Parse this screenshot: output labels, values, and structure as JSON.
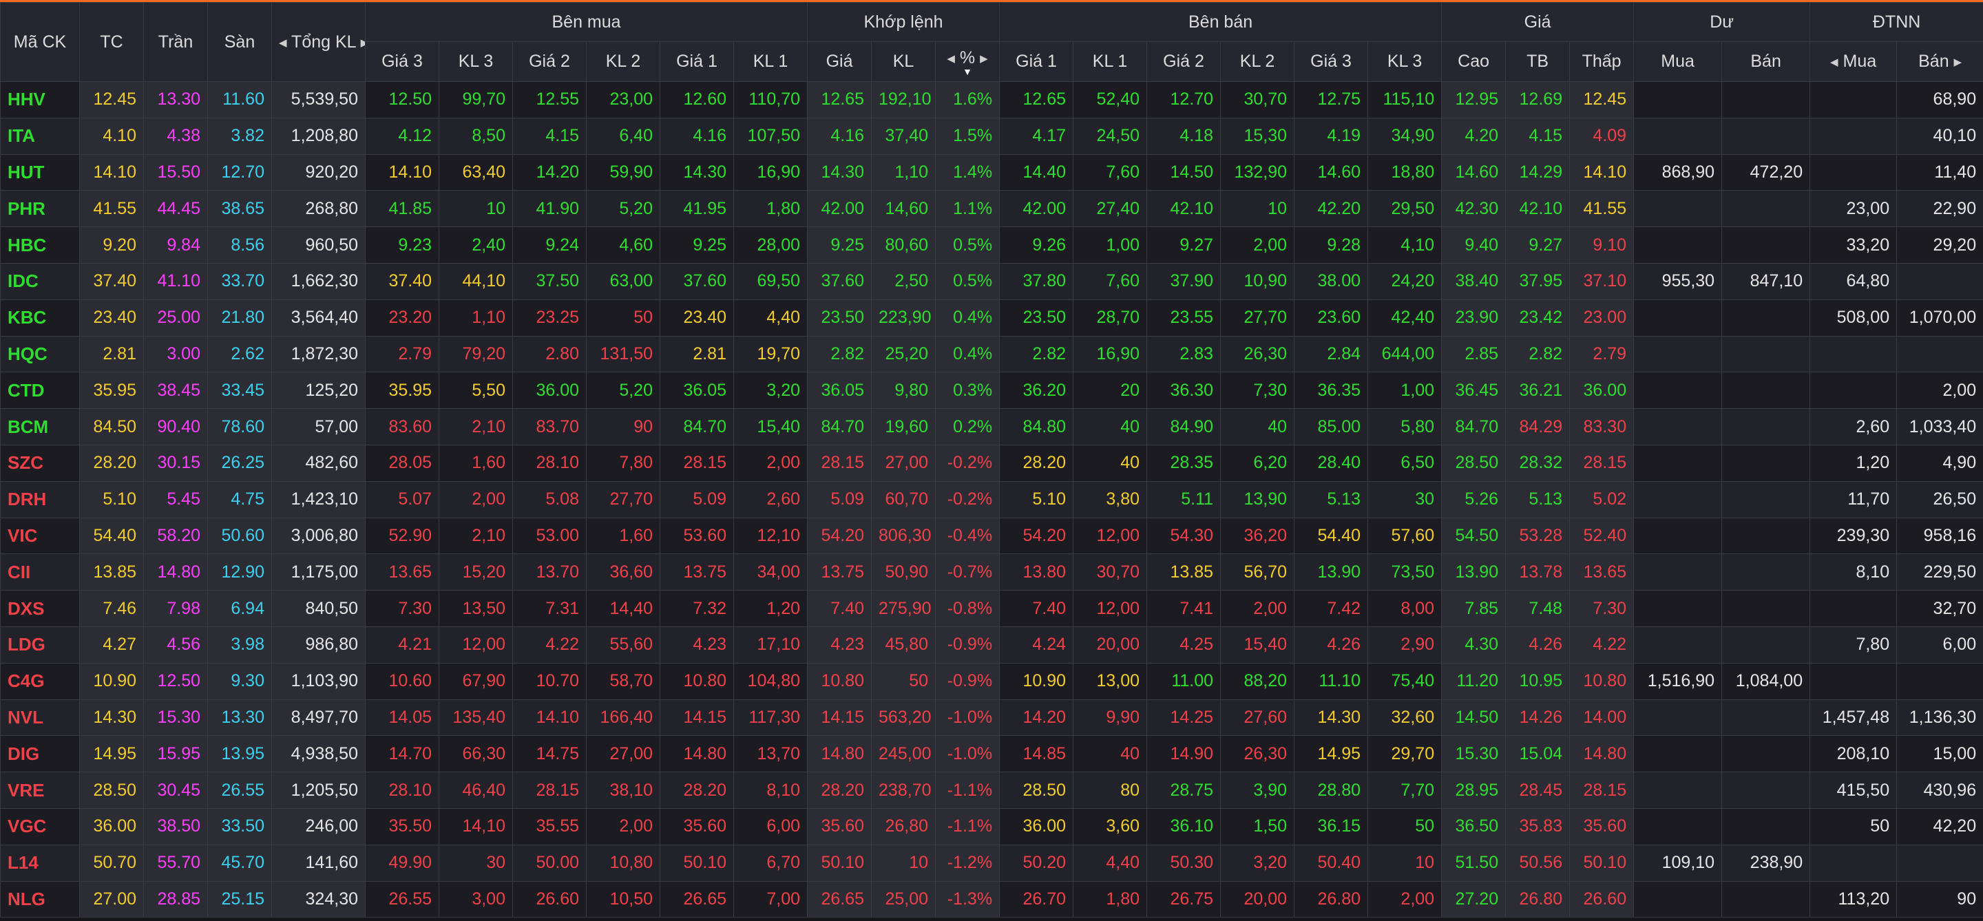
{
  "headers": {
    "symbol": "Mã CK",
    "ref": "TC",
    "ceil": "Trần",
    "floor": "Sàn",
    "total_vol": "Tổng KL",
    "buy_group": "Bên mua",
    "match_group": "Khớp lệnh",
    "sell_group": "Bên bán",
    "price_group": "Giá",
    "remain_group": "Dư",
    "foreign_group": "ĐTNN",
    "buy_cols": [
      "Giá 3",
      "KL 3",
      "Giá 2",
      "KL 2",
      "Giá 1",
      "KL 1"
    ],
    "match_cols": [
      "Giá",
      "KL",
      "%"
    ],
    "sell_cols": [
      "Giá 1",
      "KL 1",
      "Giá 2",
      "KL 2",
      "Giá 3",
      "KL 3"
    ],
    "price_cols": [
      "Cao",
      "TB",
      "Thấp"
    ],
    "remain_cols": [
      "Mua",
      "Bán"
    ],
    "foreign_cols": [
      "Mua",
      "Bán"
    ]
  },
  "colors": {
    "up": "#2ede2e",
    "down": "#f04048",
    "ref": "#f2cc2a",
    "ceil": "#ff3dff",
    "floor": "#3ad1ef",
    "accent": "#f26b1d"
  },
  "rows": [
    {
      "sym": "HHV",
      "tc": "12.45",
      "tran": "13.30",
      "san": "11.60",
      "tkl": "5,539,50",
      "b3p": "12.50",
      "b3v": "99,70",
      "b2p": "12.55",
      "b2v": "23,00",
      "b1p": "12.60",
      "b1v": "110,70",
      "mp": "12.65",
      "mv": "192,10",
      "pct": "1.6%",
      "s1p": "12.65",
      "s1v": "52,40",
      "s2p": "12.70",
      "s2v": "30,70",
      "s3p": "12.75",
      "s3v": "115,10",
      "cao": "12.95",
      "tb": "12.69",
      "thap": "12.45",
      "dm": "",
      "db": "",
      "fm": "",
      "fb": "68,90",
      "cl": {
        "b3": "up",
        "b2": "up",
        "b1": "up",
        "m": "up",
        "s1": "up",
        "s2": "up",
        "s3": "up",
        "cao": "up",
        "tb": "up",
        "thap": "ref"
      }
    },
    {
      "sym": "ITA",
      "tc": "4.10",
      "tran": "4.38",
      "san": "3.82",
      "tkl": "1,208,80",
      "b3p": "4.12",
      "b3v": "8,50",
      "b2p": "4.15",
      "b2v": "6,40",
      "b1p": "4.16",
      "b1v": "107,50",
      "mp": "4.16",
      "mv": "37,40",
      "pct": "1.5%",
      "s1p": "4.17",
      "s1v": "24,50",
      "s2p": "4.18",
      "s2v": "15,30",
      "s3p": "4.19",
      "s3v": "34,90",
      "cao": "4.20",
      "tb": "4.15",
      "thap": "4.09",
      "dm": "",
      "db": "",
      "fm": "",
      "fb": "40,10",
      "cl": {
        "b3": "up",
        "b2": "up",
        "b1": "up",
        "m": "up",
        "s1": "up",
        "s2": "up",
        "s3": "up",
        "cao": "up",
        "tb": "up",
        "thap": "dn"
      }
    },
    {
      "sym": "HUT",
      "tc": "14.10",
      "tran": "15.50",
      "san": "12.70",
      "tkl": "920,20",
      "b3p": "14.10",
      "b3v": "63,40",
      "b2p": "14.20",
      "b2v": "59,90",
      "b1p": "14.30",
      "b1v": "16,90",
      "mp": "14.30",
      "mv": "1,10",
      "pct": "1.4%",
      "s1p": "14.40",
      "s1v": "7,60",
      "s2p": "14.50",
      "s2v": "132,90",
      "s3p": "14.60",
      "s3v": "18,80",
      "cao": "14.60",
      "tb": "14.29",
      "thap": "14.10",
      "dm": "868,90",
      "db": "472,20",
      "fm": "",
      "fb": "11,40",
      "cl": {
        "b3": "ref",
        "b2": "up",
        "b1": "up",
        "m": "up",
        "s1": "up",
        "s2": "up",
        "s3": "up",
        "cao": "up",
        "tb": "up",
        "thap": "ref"
      }
    },
    {
      "sym": "PHR",
      "tc": "41.55",
      "tran": "44.45",
      "san": "38.65",
      "tkl": "268,80",
      "b3p": "41.85",
      "b3v": "10",
      "b2p": "41.90",
      "b2v": "5,20",
      "b1p": "41.95",
      "b1v": "1,80",
      "mp": "42.00",
      "mv": "14,60",
      "pct": "1.1%",
      "s1p": "42.00",
      "s1v": "27,40",
      "s2p": "42.10",
      "s2v": "10",
      "s3p": "42.20",
      "s3v": "29,50",
      "cao": "42.30",
      "tb": "42.10",
      "thap": "41.55",
      "dm": "",
      "db": "",
      "fm": "23,00",
      "fb": "22,90",
      "cl": {
        "b3": "up",
        "b2": "up",
        "b1": "up",
        "m": "up",
        "s1": "up",
        "s2": "up",
        "s3": "up",
        "cao": "up",
        "tb": "up",
        "thap": "ref"
      }
    },
    {
      "sym": "HBC",
      "tc": "9.20",
      "tran": "9.84",
      "san": "8.56",
      "tkl": "960,50",
      "b3p": "9.23",
      "b3v": "2,40",
      "b2p": "9.24",
      "b2v": "4,60",
      "b1p": "9.25",
      "b1v": "28,00",
      "mp": "9.25",
      "mv": "80,60",
      "pct": "0.5%",
      "s1p": "9.26",
      "s1v": "1,00",
      "s2p": "9.27",
      "s2v": "2,00",
      "s3p": "9.28",
      "s3v": "4,10",
      "cao": "9.40",
      "tb": "9.27",
      "thap": "9.10",
      "dm": "",
      "db": "",
      "fm": "33,20",
      "fb": "29,20",
      "cl": {
        "b3": "up",
        "b2": "up",
        "b1": "up",
        "m": "up",
        "s1": "up",
        "s2": "up",
        "s3": "up",
        "cao": "up",
        "tb": "up",
        "thap": "dn"
      }
    },
    {
      "sym": "IDC",
      "tc": "37.40",
      "tran": "41.10",
      "san": "33.70",
      "tkl": "1,662,30",
      "b3p": "37.40",
      "b3v": "44,10",
      "b2p": "37.50",
      "b2v": "63,00",
      "b1p": "37.60",
      "b1v": "69,50",
      "mp": "37.60",
      "mv": "2,50",
      "pct": "0.5%",
      "s1p": "37.80",
      "s1v": "7,60",
      "s2p": "37.90",
      "s2v": "10,90",
      "s3p": "38.00",
      "s3v": "24,20",
      "cao": "38.40",
      "tb": "37.95",
      "thap": "37.10",
      "dm": "955,30",
      "db": "847,10",
      "fm": "64,80",
      "fb": "",
      "cl": {
        "b3": "ref",
        "b2": "up",
        "b1": "up",
        "m": "up",
        "s1": "up",
        "s2": "up",
        "s3": "up",
        "cao": "up",
        "tb": "up",
        "thap": "dn"
      }
    },
    {
      "sym": "KBC",
      "tc": "23.40",
      "tran": "25.00",
      "san": "21.80",
      "tkl": "3,564,40",
      "b3p": "23.20",
      "b3v": "1,10",
      "b2p": "23.25",
      "b2v": "50",
      "b1p": "23.40",
      "b1v": "4,40",
      "mp": "23.50",
      "mv": "223,90",
      "pct": "0.4%",
      "s1p": "23.50",
      "s1v": "28,70",
      "s2p": "23.55",
      "s2v": "27,70",
      "s3p": "23.60",
      "s3v": "42,40",
      "cao": "23.90",
      "tb": "23.42",
      "thap": "23.00",
      "dm": "",
      "db": "",
      "fm": "508,00",
      "fb": "1,070,00",
      "cl": {
        "b3": "dn",
        "b2": "dn",
        "b1": "ref",
        "m": "up",
        "s1": "up",
        "s2": "up",
        "s3": "up",
        "cao": "up",
        "tb": "up",
        "thap": "dn"
      }
    },
    {
      "sym": "HQC",
      "tc": "2.81",
      "tran": "3.00",
      "san": "2.62",
      "tkl": "1,872,30",
      "b3p": "2.79",
      "b3v": "79,20",
      "b2p": "2.80",
      "b2v": "131,50",
      "b1p": "2.81",
      "b1v": "19,70",
      "mp": "2.82",
      "mv": "25,20",
      "pct": "0.4%",
      "s1p": "2.82",
      "s1v": "16,90",
      "s2p": "2.83",
      "s2v": "26,30",
      "s3p": "2.84",
      "s3v": "644,00",
      "cao": "2.85",
      "tb": "2.82",
      "thap": "2.79",
      "dm": "",
      "db": "",
      "fm": "",
      "fb": "",
      "cl": {
        "b3": "dn",
        "b2": "dn",
        "b1": "ref",
        "m": "up",
        "s1": "up",
        "s2": "up",
        "s3": "up",
        "cao": "up",
        "tb": "up",
        "thap": "dn"
      }
    },
    {
      "sym": "CTD",
      "tc": "35.95",
      "tran": "38.45",
      "san": "33.45",
      "tkl": "125,20",
      "b3p": "35.95",
      "b3v": "5,50",
      "b2p": "36.00",
      "b2v": "5,20",
      "b1p": "36.05",
      "b1v": "3,20",
      "mp": "36.05",
      "mv": "9,80",
      "pct": "0.3%",
      "s1p": "36.20",
      "s1v": "20",
      "s2p": "36.30",
      "s2v": "7,30",
      "s3p": "36.35",
      "s3v": "1,00",
      "cao": "36.45",
      "tb": "36.21",
      "thap": "36.00",
      "dm": "",
      "db": "",
      "fm": "",
      "fb": "2,00",
      "cl": {
        "b3": "ref",
        "b2": "up",
        "b1": "up",
        "m": "up",
        "s1": "up",
        "s2": "up",
        "s3": "up",
        "cao": "up",
        "tb": "up",
        "thap": "up"
      }
    },
    {
      "sym": "BCM",
      "tc": "84.50",
      "tran": "90.40",
      "san": "78.60",
      "tkl": "57,00",
      "b3p": "83.60",
      "b3v": "2,10",
      "b2p": "83.70",
      "b2v": "90",
      "b1p": "84.70",
      "b1v": "15,40",
      "mp": "84.70",
      "mv": "19,60",
      "pct": "0.2%",
      "s1p": "84.80",
      "s1v": "40",
      "s2p": "84.90",
      "s2v": "40",
      "s3p": "85.00",
      "s3v": "5,80",
      "cao": "84.70",
      "tb": "84.29",
      "thap": "83.30",
      "dm": "",
      "db": "",
      "fm": "2,60",
      "fb": "1,033,40",
      "cl": {
        "b3": "dn",
        "b2": "dn",
        "b1": "up",
        "m": "up",
        "s1": "up",
        "s2": "up",
        "s3": "up",
        "cao": "up",
        "tb": "dn",
        "thap": "dn"
      }
    },
    {
      "sym": "SZC",
      "tc": "28.20",
      "tran": "30.15",
      "san": "26.25",
      "tkl": "482,60",
      "b3p": "28.05",
      "b3v": "1,60",
      "b2p": "28.10",
      "b2v": "7,80",
      "b1p": "28.15",
      "b1v": "2,00",
      "mp": "28.15",
      "mv": "27,00",
      "pct": "-0.2%",
      "s1p": "28.20",
      "s1v": "40",
      "s2p": "28.35",
      "s2v": "6,20",
      "s3p": "28.40",
      "s3v": "6,50",
      "cao": "28.50",
      "tb": "28.32",
      "thap": "28.15",
      "dm": "",
      "db": "",
      "fm": "1,20",
      "fb": "4,90",
      "cl": {
        "b3": "dn",
        "b2": "dn",
        "b1": "dn",
        "m": "dn",
        "s1": "ref",
        "s2": "up",
        "s3": "up",
        "cao": "up",
        "tb": "up",
        "thap": "dn"
      }
    },
    {
      "sym": "DRH",
      "tc": "5.10",
      "tran": "5.45",
      "san": "4.75",
      "tkl": "1,423,10",
      "b3p": "5.07",
      "b3v": "2,00",
      "b2p": "5.08",
      "b2v": "27,70",
      "b1p": "5.09",
      "b1v": "2,60",
      "mp": "5.09",
      "mv": "60,70",
      "pct": "-0.2%",
      "s1p": "5.10",
      "s1v": "3,80",
      "s2p": "5.11",
      "s2v": "13,90",
      "s3p": "5.13",
      "s3v": "30",
      "cao": "5.26",
      "tb": "5.13",
      "thap": "5.02",
      "dm": "",
      "db": "",
      "fm": "11,70",
      "fb": "26,50",
      "cl": {
        "b3": "dn",
        "b2": "dn",
        "b1": "dn",
        "m": "dn",
        "s1": "ref",
        "s2": "up",
        "s3": "up",
        "cao": "up",
        "tb": "up",
        "thap": "dn"
      }
    },
    {
      "sym": "VIC",
      "tc": "54.40",
      "tran": "58.20",
      "san": "50.60",
      "tkl": "3,006,80",
      "b3p": "52.90",
      "b3v": "2,10",
      "b2p": "53.00",
      "b2v": "1,60",
      "b1p": "53.60",
      "b1v": "12,10",
      "mp": "54.20",
      "mv": "806,30",
      "pct": "-0.4%",
      "s1p": "54.20",
      "s1v": "12,00",
      "s2p": "54.30",
      "s2v": "36,20",
      "s3p": "54.40",
      "s3v": "57,60",
      "cao": "54.50",
      "tb": "53.28",
      "thap": "52.40",
      "dm": "",
      "db": "",
      "fm": "239,30",
      "fb": "958,16",
      "cl": {
        "b3": "dn",
        "b2": "dn",
        "b1": "dn",
        "m": "dn",
        "s1": "dn",
        "s2": "dn",
        "s3": "ref",
        "cao": "up",
        "tb": "dn",
        "thap": "dn"
      }
    },
    {
      "sym": "CII",
      "tc": "13.85",
      "tran": "14.80",
      "san": "12.90",
      "tkl": "1,175,00",
      "b3p": "13.65",
      "b3v": "15,20",
      "b2p": "13.70",
      "b2v": "36,60",
      "b1p": "13.75",
      "b1v": "34,00",
      "mp": "13.75",
      "mv": "50,90",
      "pct": "-0.7%",
      "s1p": "13.80",
      "s1v": "30,70",
      "s2p": "13.85",
      "s2v": "56,70",
      "s3p": "13.90",
      "s3v": "73,50",
      "cao": "13.90",
      "tb": "13.78",
      "thap": "13.65",
      "dm": "",
      "db": "",
      "fm": "8,10",
      "fb": "229,50",
      "cl": {
        "b3": "dn",
        "b2": "dn",
        "b1": "dn",
        "m": "dn",
        "s1": "dn",
        "s2": "ref",
        "s3": "up",
        "cao": "up",
        "tb": "dn",
        "thap": "dn"
      }
    },
    {
      "sym": "DXS",
      "tc": "7.46",
      "tran": "7.98",
      "san": "6.94",
      "tkl": "840,50",
      "b3p": "7.30",
      "b3v": "13,50",
      "b2p": "7.31",
      "b2v": "14,40",
      "b1p": "7.32",
      "b1v": "1,20",
      "mp": "7.40",
      "mv": "275,90",
      "pct": "-0.8%",
      "s1p": "7.40",
      "s1v": "12,00",
      "s2p": "7.41",
      "s2v": "2,00",
      "s3p": "7.42",
      "s3v": "8,00",
      "cao": "7.85",
      "tb": "7.48",
      "thap": "7.30",
      "dm": "",
      "db": "",
      "fm": "",
      "fb": "32,70",
      "cl": {
        "b3": "dn",
        "b2": "dn",
        "b1": "dn",
        "m": "dn",
        "s1": "dn",
        "s2": "dn",
        "s3": "dn",
        "cao": "up",
        "tb": "up",
        "thap": "dn"
      }
    },
    {
      "sym": "LDG",
      "tc": "4.27",
      "tran": "4.56",
      "san": "3.98",
      "tkl": "986,80",
      "b3p": "4.21",
      "b3v": "12,00",
      "b2p": "4.22",
      "b2v": "55,60",
      "b1p": "4.23",
      "b1v": "17,10",
      "mp": "4.23",
      "mv": "45,80",
      "pct": "-0.9%",
      "s1p": "4.24",
      "s1v": "20,00",
      "s2p": "4.25",
      "s2v": "15,40",
      "s3p": "4.26",
      "s3v": "2,90",
      "cao": "4.30",
      "tb": "4.26",
      "thap": "4.22",
      "dm": "",
      "db": "",
      "fm": "7,80",
      "fb": "6,00",
      "cl": {
        "b3": "dn",
        "b2": "dn",
        "b1": "dn",
        "m": "dn",
        "s1": "dn",
        "s2": "dn",
        "s3": "dn",
        "cao": "up",
        "tb": "dn",
        "thap": "dn"
      }
    },
    {
      "sym": "C4G",
      "tc": "10.90",
      "tran": "12.50",
      "san": "9.30",
      "tkl": "1,103,90",
      "b3p": "10.60",
      "b3v": "67,90",
      "b2p": "10.70",
      "b2v": "58,70",
      "b1p": "10.80",
      "b1v": "104,80",
      "mp": "10.80",
      "mv": "50",
      "pct": "-0.9%",
      "s1p": "10.90",
      "s1v": "13,00",
      "s2p": "11.00",
      "s2v": "88,20",
      "s3p": "11.10",
      "s3v": "75,40",
      "cao": "11.20",
      "tb": "10.95",
      "thap": "10.80",
      "dm": "1,516,90",
      "db": "1,084,00",
      "fm": "",
      "fb": "",
      "cl": {
        "b3": "dn",
        "b2": "dn",
        "b1": "dn",
        "m": "dn",
        "s1": "ref",
        "s2": "up",
        "s3": "up",
        "cao": "up",
        "tb": "up",
        "thap": "dn"
      }
    },
    {
      "sym": "NVL",
      "tc": "14.30",
      "tran": "15.30",
      "san": "13.30",
      "tkl": "8,497,70",
      "b3p": "14.05",
      "b3v": "135,40",
      "b2p": "14.10",
      "b2v": "166,40",
      "b1p": "14.15",
      "b1v": "117,30",
      "mp": "14.15",
      "mv": "563,20",
      "pct": "-1.0%",
      "s1p": "14.20",
      "s1v": "9,90",
      "s2p": "14.25",
      "s2v": "27,60",
      "s3p": "14.30",
      "s3v": "32,60",
      "cao": "14.50",
      "tb": "14.26",
      "thap": "14.00",
      "dm": "",
      "db": "",
      "fm": "1,457,48",
      "fb": "1,136,30",
      "cl": {
        "b3": "dn",
        "b2": "dn",
        "b1": "dn",
        "m": "dn",
        "s1": "dn",
        "s2": "dn",
        "s3": "ref",
        "cao": "up",
        "tb": "dn",
        "thap": "dn"
      }
    },
    {
      "sym": "DIG",
      "tc": "14.95",
      "tran": "15.95",
      "san": "13.95",
      "tkl": "4,938,50",
      "b3p": "14.70",
      "b3v": "66,30",
      "b2p": "14.75",
      "b2v": "27,00",
      "b1p": "14.80",
      "b1v": "13,70",
      "mp": "14.80",
      "mv": "245,00",
      "pct": "-1.0%",
      "s1p": "14.85",
      "s1v": "40",
      "s2p": "14.90",
      "s2v": "26,30",
      "s3p": "14.95",
      "s3v": "29,70",
      "cao": "15.30",
      "tb": "15.04",
      "thap": "14.80",
      "dm": "",
      "db": "",
      "fm": "208,10",
      "fb": "15,00",
      "cl": {
        "b3": "dn",
        "b2": "dn",
        "b1": "dn",
        "m": "dn",
        "s1": "dn",
        "s2": "dn",
        "s3": "ref",
        "cao": "up",
        "tb": "up",
        "thap": "dn"
      }
    },
    {
      "sym": "VRE",
      "tc": "28.50",
      "tran": "30.45",
      "san": "26.55",
      "tkl": "1,205,50",
      "b3p": "28.10",
      "b3v": "46,40",
      "b2p": "28.15",
      "b2v": "38,10",
      "b1p": "28.20",
      "b1v": "8,10",
      "mp": "28.20",
      "mv": "238,70",
      "pct": "-1.1%",
      "s1p": "28.50",
      "s1v": "80",
      "s2p": "28.75",
      "s2v": "3,90",
      "s3p": "28.80",
      "s3v": "7,70",
      "cao": "28.95",
      "tb": "28.45",
      "thap": "28.15",
      "dm": "",
      "db": "",
      "fm": "415,50",
      "fb": "430,96",
      "cl": {
        "b3": "dn",
        "b2": "dn",
        "b1": "dn",
        "m": "dn",
        "s1": "ref",
        "s2": "up",
        "s3": "up",
        "cao": "up",
        "tb": "dn",
        "thap": "dn"
      }
    },
    {
      "sym": "VGC",
      "tc": "36.00",
      "tran": "38.50",
      "san": "33.50",
      "tkl": "246,00",
      "b3p": "35.50",
      "b3v": "14,10",
      "b2p": "35.55",
      "b2v": "2,00",
      "b1p": "35.60",
      "b1v": "6,00",
      "mp": "35.60",
      "mv": "26,80",
      "pct": "-1.1%",
      "s1p": "36.00",
      "s1v": "3,60",
      "s2p": "36.10",
      "s2v": "1,50",
      "s3p": "36.15",
      "s3v": "50",
      "cao": "36.50",
      "tb": "35.83",
      "thap": "35.60",
      "dm": "",
      "db": "",
      "fm": "50",
      "fb": "42,20",
      "cl": {
        "b3": "dn",
        "b2": "dn",
        "b1": "dn",
        "m": "dn",
        "s1": "ref",
        "s2": "up",
        "s3": "up",
        "cao": "up",
        "tb": "dn",
        "thap": "dn"
      }
    },
    {
      "sym": "L14",
      "tc": "50.70",
      "tran": "55.70",
      "san": "45.70",
      "tkl": "141,60",
      "b3p": "49.90",
      "b3v": "30",
      "b2p": "50.00",
      "b2v": "10,80",
      "b1p": "50.10",
      "b1v": "6,70",
      "mp": "50.10",
      "mv": "10",
      "pct": "-1.2%",
      "s1p": "50.20",
      "s1v": "4,40",
      "s2p": "50.30",
      "s2v": "3,20",
      "s3p": "50.40",
      "s3v": "10",
      "cao": "51.50",
      "tb": "50.56",
      "thap": "50.10",
      "dm": "109,10",
      "db": "238,90",
      "fm": "",
      "fb": "",
      "cl": {
        "b3": "dn",
        "b2": "dn",
        "b1": "dn",
        "m": "dn",
        "s1": "dn",
        "s2": "dn",
        "s3": "dn",
        "cao": "up",
        "tb": "dn",
        "thap": "dn"
      }
    },
    {
      "sym": "NLG",
      "tc": "27.00",
      "tran": "28.85",
      "san": "25.15",
      "tkl": "324,30",
      "b3p": "26.55",
      "b3v": "3,00",
      "b2p": "26.60",
      "b2v": "10,50",
      "b1p": "26.65",
      "b1v": "7,00",
      "mp": "26.65",
      "mv": "25,00",
      "pct": "-1.3%",
      "s1p": "26.70",
      "s1v": "1,80",
      "s2p": "26.75",
      "s2v": "20,00",
      "s3p": "26.80",
      "s3v": "2,00",
      "cao": "27.20",
      "tb": "26.80",
      "thap": "26.60",
      "dm": "",
      "db": "",
      "fm": "113,20",
      "fb": "90",
      "cl": {
        "b3": "dn",
        "b2": "dn",
        "b1": "dn",
        "m": "dn",
        "s1": "dn",
        "s2": "dn",
        "s3": "dn",
        "cao": "up",
        "tb": "dn",
        "thap": "dn"
      }
    }
  ]
}
